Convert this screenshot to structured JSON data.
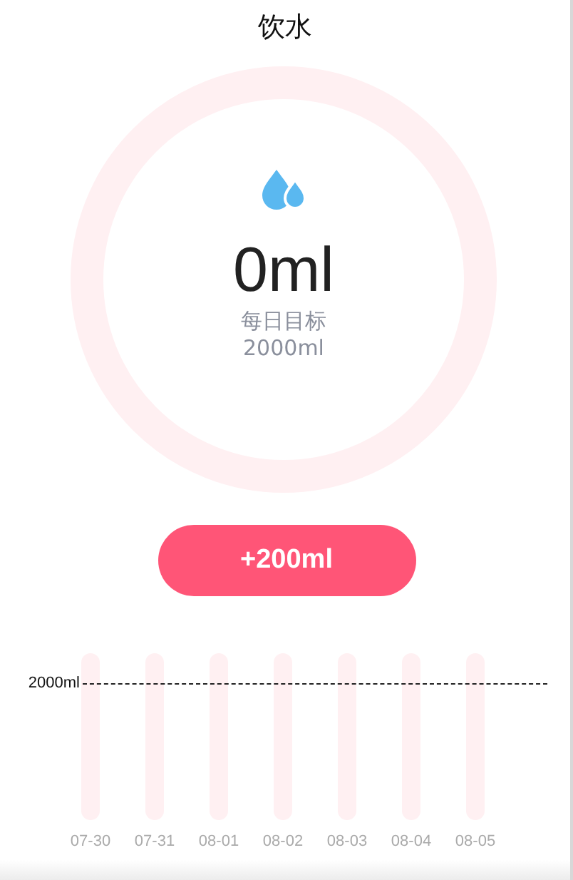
{
  "title": "饮水",
  "progress": {
    "amount": "0ml",
    "goal_label": "每日目标",
    "goal_value": "2000ml"
  },
  "add_button": "+200ml",
  "history": {
    "target_label": "2000ml",
    "days": [
      {
        "label": "07-30",
        "level": 0
      },
      {
        "label": "07-31",
        "level": 0
      },
      {
        "label": "08-01",
        "level": 0
      },
      {
        "label": "08-02",
        "level": 0
      },
      {
        "label": "08-03",
        "level": 0
      },
      {
        "label": "08-04",
        "level": 0
      },
      {
        "label": "08-05",
        "level": 0
      }
    ]
  }
}
